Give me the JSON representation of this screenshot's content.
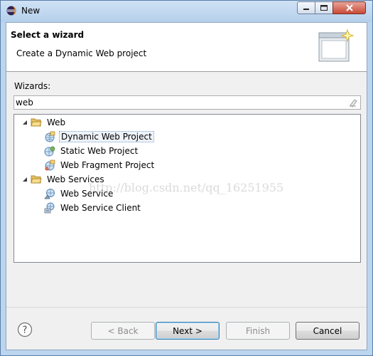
{
  "window": {
    "title": "New",
    "title_icon": "eclipse-icon",
    "controls": [
      "minimize-icon",
      "maximize-icon",
      "close-icon"
    ]
  },
  "header": {
    "title": "Select a wizard",
    "description": "Create a Dynamic Web project",
    "banner_icon": "wizard-banner-icon"
  },
  "filter": {
    "label": "Wizards:",
    "value": "web",
    "clear_icon": "clear-filter-icon"
  },
  "tree": {
    "groups": [
      {
        "label": "Web",
        "expanded": true,
        "icon": "folder-open-icon",
        "items": [
          {
            "label": "Dynamic Web Project",
            "icon": "dynamic-web-project-icon",
            "selected": true
          },
          {
            "label": "Static Web Project",
            "icon": "static-web-project-icon",
            "selected": false
          },
          {
            "label": "Web Fragment Project",
            "icon": "web-fragment-project-icon",
            "selected": false
          }
        ]
      },
      {
        "label": "Web Services",
        "expanded": true,
        "icon": "folder-open-icon",
        "items": [
          {
            "label": "Web Service",
            "icon": "web-service-icon",
            "selected": false
          },
          {
            "label": "Web Service Client",
            "icon": "web-service-client-icon",
            "selected": false
          }
        ]
      }
    ]
  },
  "watermark": "http://blog.csdn.net/qq_16251955",
  "buttons": {
    "help_icon": "help-icon",
    "back": "< Back",
    "next": "Next >",
    "finish": "Finish",
    "cancel": "Cancel"
  },
  "colors": {
    "selection_border": "#7da2ce",
    "default_button_border": "#3c7fb1"
  }
}
